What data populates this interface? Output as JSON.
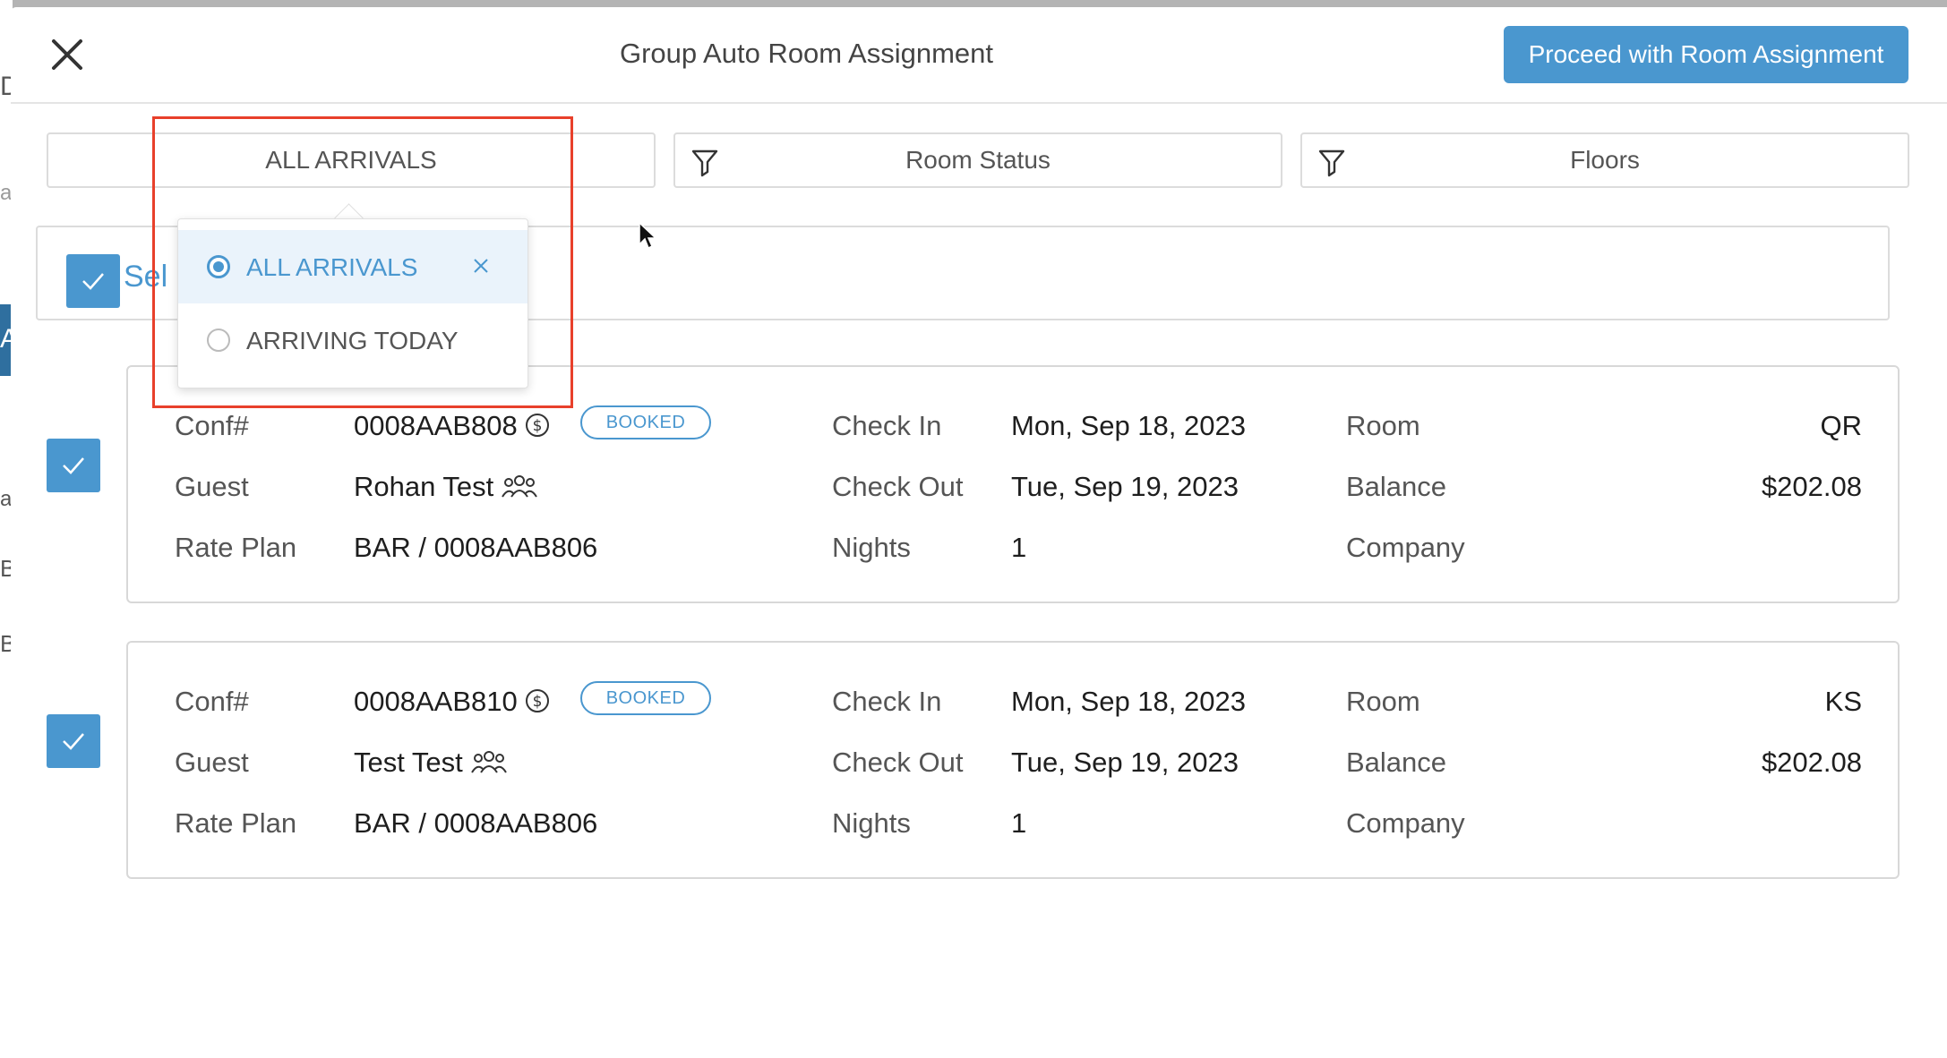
{
  "background": {
    "fragments": [
      "D",
      "a",
      "A",
      "at",
      "B",
      "B"
    ]
  },
  "modal": {
    "title": "Group Auto Room Assignment",
    "proceed_label": "Proceed with Room Assignment",
    "close_icon": "close-icon"
  },
  "filters": {
    "arrival": "ALL ARRIVALS",
    "room_status": "Room Status",
    "floors": "Floors"
  },
  "select_all": {
    "label": "Sel",
    "checked": true
  },
  "dropdown": {
    "options": [
      {
        "label": "ALL ARRIVALS",
        "selected": true
      },
      {
        "label": "ARRIVING TODAY",
        "selected": false
      }
    ]
  },
  "labels": {
    "conf": "Conf#",
    "guest": "Guest",
    "rate_plan": "Rate Plan",
    "check_in": "Check In",
    "check_out": "Check Out",
    "nights": "Nights",
    "room": "Room",
    "balance": "Balance",
    "company": "Company"
  },
  "reservations": [
    {
      "conf": "0008AAB808",
      "status": "BOOKED",
      "guest": "Rohan Test",
      "rate_plan": "BAR / 0008AAB806",
      "check_in": "Mon, Sep 18, 2023",
      "check_out": "Tue, Sep 19, 2023",
      "nights": "1",
      "room": "QR",
      "balance": "$202.08",
      "company": "",
      "checked": true
    },
    {
      "conf": "0008AAB810",
      "status": "BOOKED",
      "guest": "Test Test",
      "rate_plan": "BAR / 0008AAB806",
      "check_in": "Mon, Sep 18, 2023",
      "check_out": "Tue, Sep 19, 2023",
      "nights": "1",
      "room": "KS",
      "balance": "$202.08",
      "company": "",
      "checked": true
    }
  ],
  "colors": {
    "accent": "#4a97cf",
    "highlight": "#e8402b"
  }
}
